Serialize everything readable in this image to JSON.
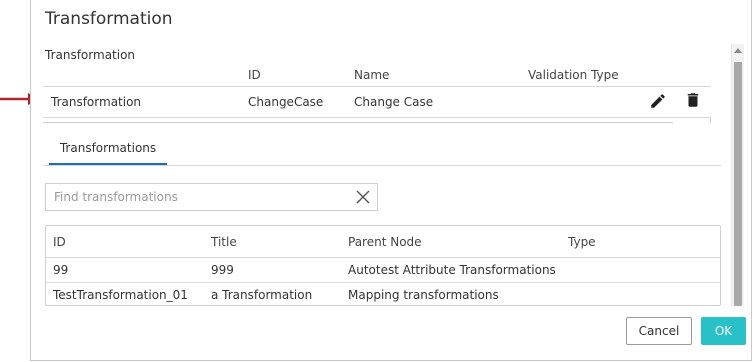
{
  "dialog": {
    "title": "Transformation"
  },
  "selected_section": {
    "label": "Transformation",
    "columns": {
      "id": "ID",
      "name": "Name",
      "validation_type": "Validation Type"
    },
    "row": {
      "type": "Transformation",
      "id": "ChangeCase",
      "name": "Change Case",
      "validation_type": ""
    },
    "icons": {
      "edit": "pencil-icon",
      "delete": "trash-icon"
    }
  },
  "tabs": [
    {
      "label": "Transformations",
      "active": true
    }
  ],
  "search": {
    "placeholder": "Find transformations",
    "value": ""
  },
  "results_table": {
    "headers": {
      "id": "ID",
      "title": "Title",
      "parent_node": "Parent Node",
      "type": "Type"
    },
    "rows": [
      {
        "id": "99",
        "title": "999",
        "parent_node": "Autotest Attribute Transformations",
        "type": ""
      },
      {
        "id": "TestTransformation_01",
        "title": "a Transformation",
        "parent_node": "Mapping transformations",
        "type": ""
      }
    ]
  },
  "footer": {
    "cancel_label": "Cancel",
    "ok_label": "OK"
  },
  "colors": {
    "accent": "#27c1c7",
    "tab_underline": "#1e6eb4",
    "arrow": "#b1262c"
  }
}
